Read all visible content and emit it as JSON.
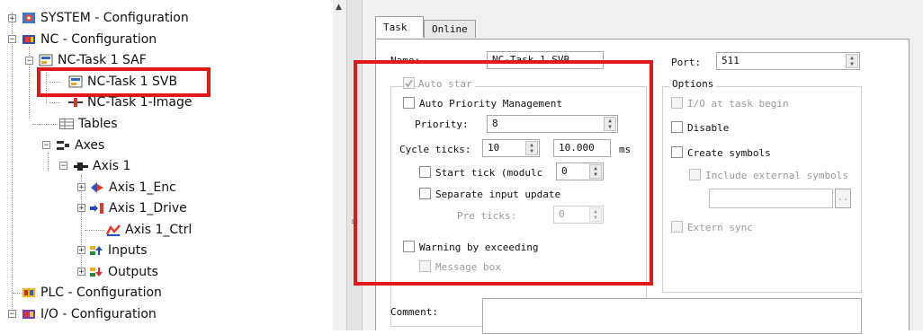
{
  "tree": {
    "system": "SYSTEM - Configuration",
    "nc": "NC - Configuration",
    "nc_task_saf": "NC-Task 1 SAF",
    "nc_task_svb": "NC-Task 1 SVB",
    "nc_task_image": "NC-Task 1-Image",
    "tables": "Tables",
    "axes": "Axes",
    "axis1": "Axis 1",
    "axis1_enc": "Axis 1_Enc",
    "axis1_drive": "Axis 1_Drive",
    "axis1_ctrl": "Axis 1_Ctrl",
    "inputs": "Inputs",
    "outputs": "Outputs",
    "plc": "PLC - Configuration",
    "io": "I/O - Configuration"
  },
  "tabs": [
    "Task",
    "Online"
  ],
  "task": {
    "name_label": "Name:",
    "name_value": "NC-Task 1 SVB",
    "port_label": "Port:",
    "port_value": "511",
    "auto_start": "Auto star",
    "auto_priority": "Auto Priority Management",
    "priority_label": "Priority:",
    "priority_value": "8",
    "cycle_ticks_label": "Cycle ticks:",
    "cycle_ticks_value": "10",
    "cycle_ms_value": "10.000",
    "ms_unit": "ms",
    "start_tick": "Start tick (modulc",
    "start_tick_value": "0",
    "separate_input": "Separate input update",
    "pre_ticks_label": "Pre ticks:",
    "pre_ticks_value": "0",
    "warning_exceeding": "Warning by exceeding",
    "message_box": "Message box",
    "comment_label": "Comment:"
  },
  "options": {
    "title": "Options",
    "io_at_task_begin": "I/O at task begin",
    "disable": "Disable",
    "create_symbols": "Create symbols",
    "include_external": "Include external symbols",
    "browse": "..",
    "extern_sync": "Extern sync"
  },
  "colors": {
    "highlight": "#e0191c"
  }
}
